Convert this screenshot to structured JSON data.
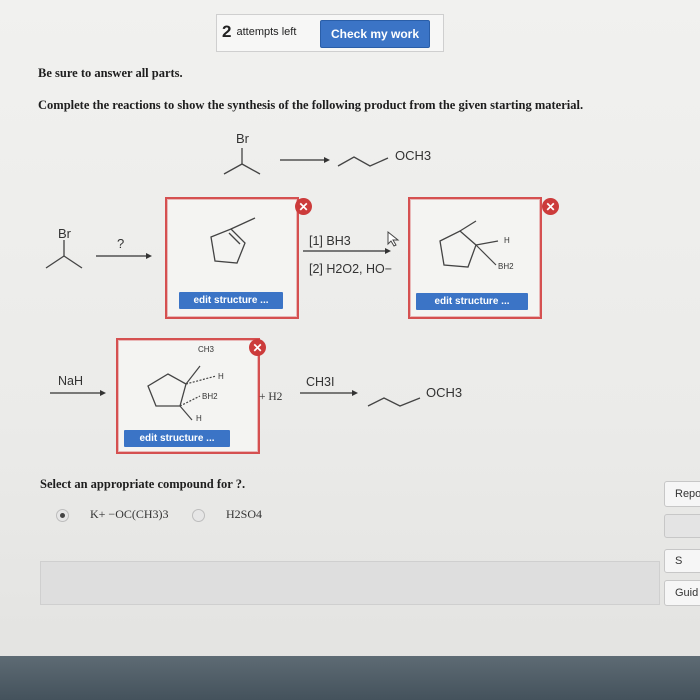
{
  "header": {
    "attempts_count": "2",
    "attempts_label": "attempts left",
    "check_button": "Check my work"
  },
  "instructions": {
    "line1": "Be sure to answer all parts.",
    "line2": "Complete the reactions to show the synthesis of the following product from the given starting material."
  },
  "overall_reaction": {
    "start_label": "Br",
    "product_label": "OCH3"
  },
  "step1": {
    "start_label": "Br",
    "reagent_unknown": "?",
    "box_edit": "edit structure ...",
    "reagent_line1": "[1] BH3",
    "reagent_line2": "[2] H2O2, HO−",
    "box2_edit": "edit structure ...",
    "box2_h_label": "H",
    "box2_bh_label": "BH2"
  },
  "step2": {
    "reagent_left": "NaH",
    "box_ch3": "CH3",
    "box_h_top": "H",
    "box_bh2": "BH2",
    "box_h_bottom": "H",
    "box_edit": "edit structure ...",
    "plus_h2": "+ H2",
    "reagent_right": "CH3I",
    "product_label": "OCH3"
  },
  "question": {
    "prompt": "Select an appropriate compound for ?.",
    "option1": "K+ −OC(CH3)3",
    "option2": "H2SO4",
    "selected": "option1"
  },
  "side_buttons": {
    "report": "Repo",
    "save": "S",
    "guide": "Guid"
  },
  "colors": {
    "accent_blue": "#3b74c6",
    "box_red": "#d55050",
    "close_red": "#cc3b3b"
  }
}
